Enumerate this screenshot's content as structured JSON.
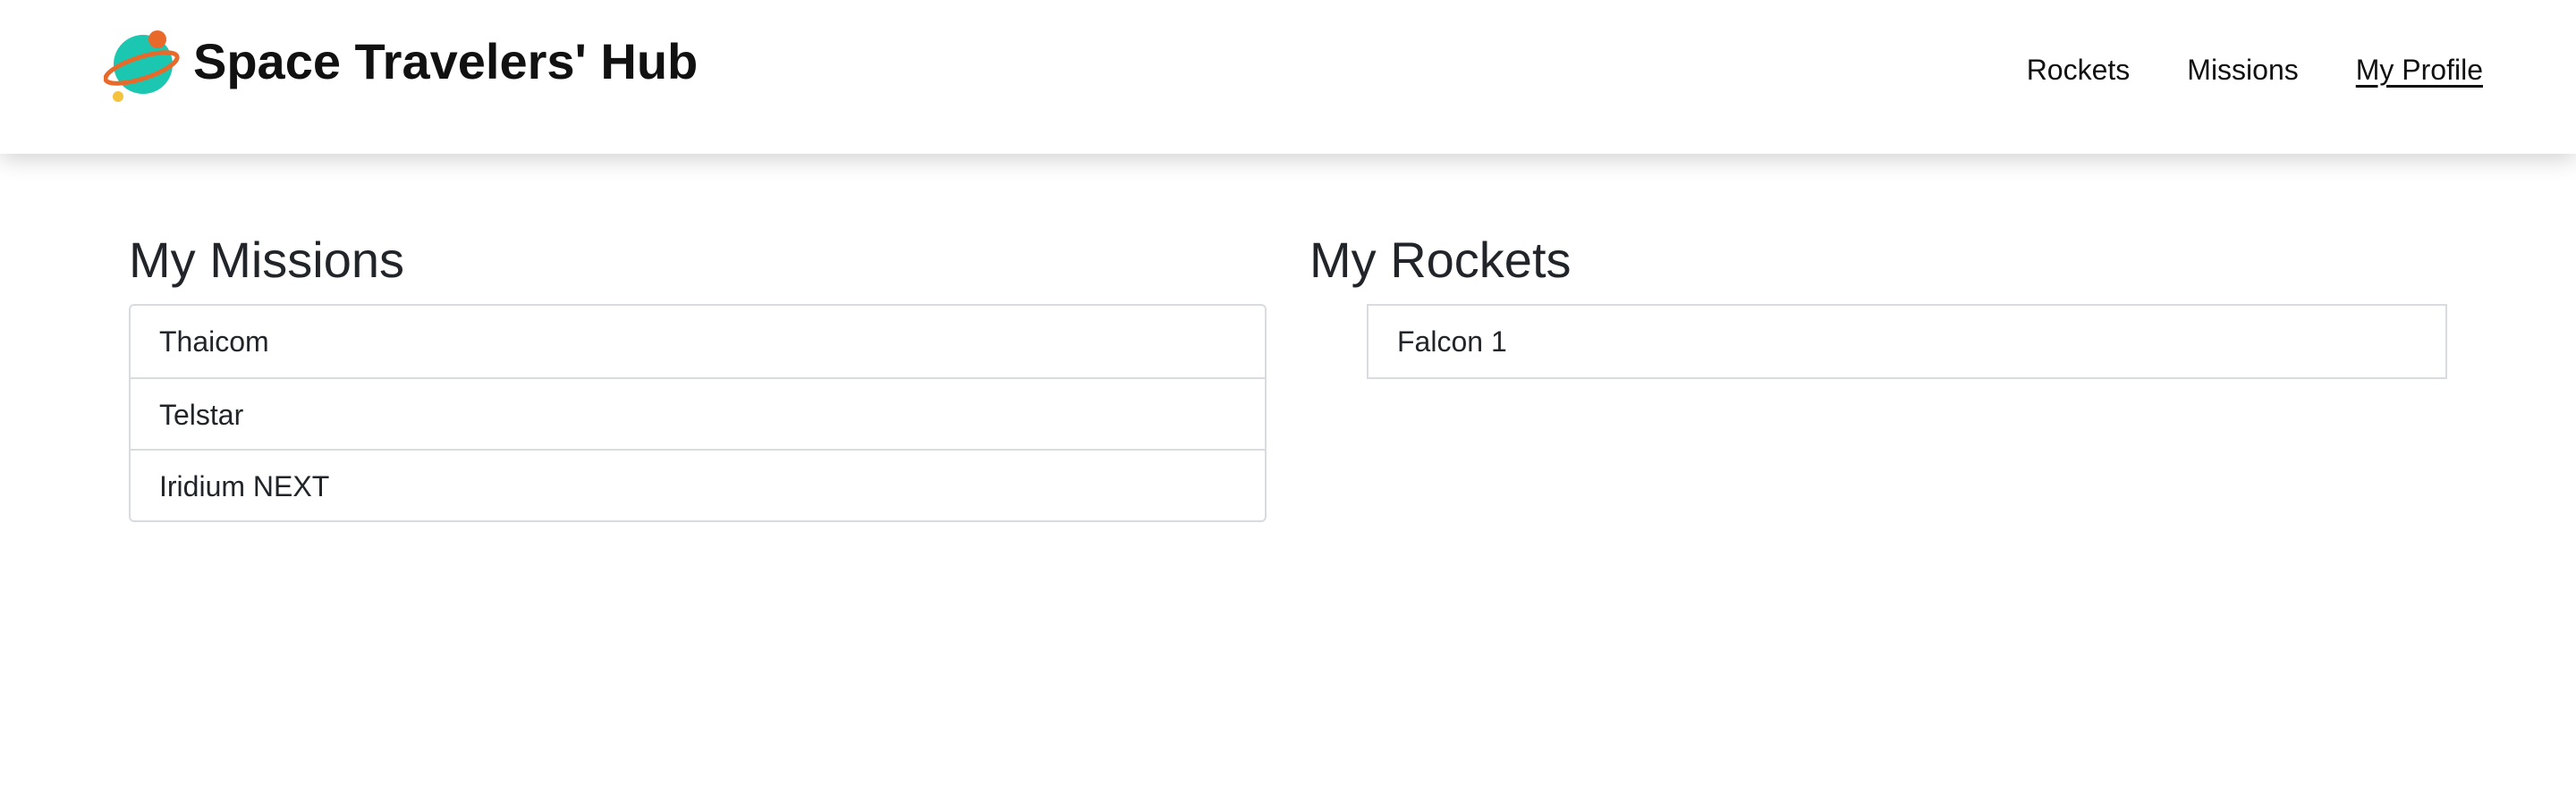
{
  "header": {
    "title": "Space Travelers' Hub",
    "logo_icon": "planet-icon",
    "nav": [
      {
        "label": "Rockets"
      },
      {
        "label": "Missions"
      },
      {
        "label": "My Profile",
        "active": true
      }
    ]
  },
  "missions": {
    "title": "My Missions",
    "items": [
      "Thaicom",
      "Telstar",
      "Iridium NEXT"
    ]
  },
  "rockets": {
    "title": "My Rockets",
    "items": [
      "Falcon 1"
    ]
  },
  "colors": {
    "planet": "#1bc7b0",
    "ring": "#e8692a",
    "moon": "#f5c23d",
    "text": "#212529",
    "border": "#d8dbdf"
  }
}
